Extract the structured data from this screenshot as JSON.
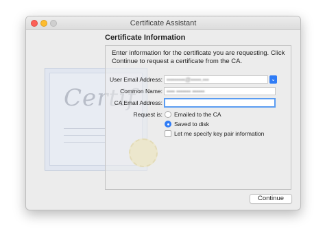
{
  "window": {
    "title": "Certificate Assistant"
  },
  "artwork": {
    "certificate_script": "Certif"
  },
  "section": {
    "heading": "Certificate Information"
  },
  "intro_text": "Enter information for the certificate you are requesting. Click Continue to request a certificate from the CA.",
  "form": {
    "user_email": {
      "label": "User Email Address:",
      "value": "•••••••••@•••••.•••"
    },
    "common_name": {
      "label": "Common Name:",
      "value": "•••• ••••••• ••••••"
    },
    "ca_email": {
      "label": "CA Email Address:",
      "value": ""
    },
    "request_is": {
      "label": "Request is:",
      "options": [
        "Emailed to the CA",
        "Saved to disk"
      ],
      "selected": "Saved to disk"
    },
    "key_pair": {
      "label": "Let me specify key pair information",
      "checked": false
    }
  },
  "buttons": {
    "continue": "Continue"
  },
  "colors": {
    "accent": "#2f7cf6",
    "close": "#fc5f57",
    "minimize": "#fdbc2e",
    "zoom_disabled": "#cfcfcf"
  },
  "icons": [
    "close-icon",
    "minimize-icon",
    "zoom-icon",
    "chevron-down-icon"
  ]
}
